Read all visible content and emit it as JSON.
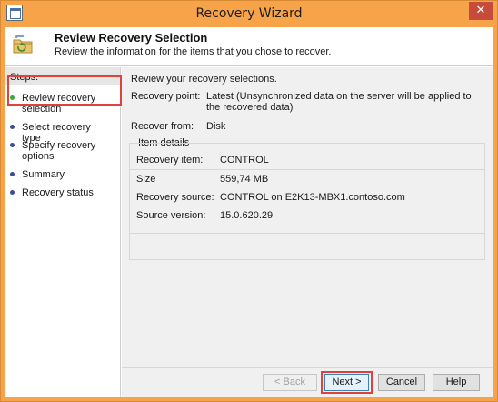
{
  "window": {
    "title": "Recovery Wizard",
    "close_glyph": "✕",
    "accent_color": "#f7a34a"
  },
  "header": {
    "title": "Review Recovery Selection",
    "subtitle": "Review the information for the items that you chose to recover."
  },
  "steps": {
    "title": "Steps:",
    "items": [
      {
        "label": "Review recovery selection",
        "state": "current"
      },
      {
        "label": "Select recovery type",
        "state": "pending"
      },
      {
        "label": "Specify recovery options",
        "state": "pending"
      },
      {
        "label": "Summary",
        "state": "pending"
      },
      {
        "label": "Recovery status",
        "state": "pending"
      }
    ]
  },
  "main": {
    "intro": "Review your recovery selections.",
    "recovery_point_label": "Recovery point:",
    "recovery_point_value": "Latest (Unsynchronized data on the server will be applied to the recovered data)",
    "recover_from_label": "Recover from:",
    "recover_from_value": "Disk",
    "item_details": {
      "legend": "Item details",
      "rows": [
        {
          "label": "Recovery item:",
          "value": "CONTROL"
        },
        {
          "label": "Size",
          "value": "559,74 MB"
        },
        {
          "label": "Recovery source:",
          "value": "CONTROL on E2K13-MBX1.contoso.com"
        },
        {
          "label": "Source version:",
          "value": "15.0.620.29"
        }
      ]
    }
  },
  "buttons": {
    "back": "< Back",
    "next": "Next >",
    "cancel": "Cancel",
    "help": "Help"
  },
  "icons": {
    "app": "wizard-app-icon",
    "header": "folder-restore-icon",
    "step_active": "green-dot-icon",
    "step_pending": "blue-dot-icon"
  },
  "highlight_color": "#e0413a"
}
